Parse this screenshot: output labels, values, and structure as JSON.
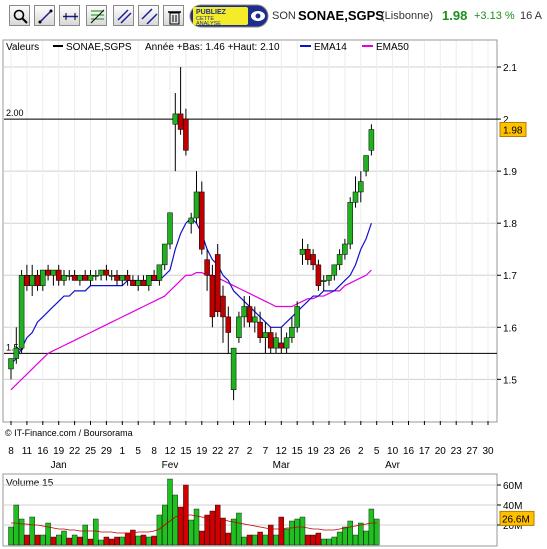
{
  "toolbar": {
    "tools": [
      {
        "icon": "zoom-icon"
      },
      {
        "icon": "trendline-icon"
      },
      {
        "icon": "horizontal-line-icon"
      },
      {
        "icon": "fibonacci-icon"
      },
      {
        "icon": "channel-icon"
      },
      {
        "icon": "parallel-lines-icon"
      },
      {
        "icon": "trash-icon"
      }
    ],
    "ad_line1": "PUBLIEZ",
    "ad_line2": "CETTE",
    "ad_line3": "ANALYSE"
  },
  "header": {
    "symbol_short": "SON",
    "symbol_name": "SONAE,SGPS",
    "exchange": "(Lisbonne)",
    "last_price": "1.98",
    "pct_change": "+3.13 %",
    "clock": "16 A"
  },
  "colors": {
    "up": "#20b020",
    "down": "#c00000",
    "ema14": "#1010d0",
    "ema50": "#e000e0",
    "volume_up": "#20c020",
    "volume_down": "#d00000",
    "grid": "#d0d0d0",
    "label_bg": "#ffc000"
  },
  "chart_data": [
    {
      "type": "candlestick",
      "legend": {
        "valeurs": "Valeurs",
        "symbol": "SONAE,SGPS",
        "range": "Année +Bas: 1.46 +Haut: 2.10",
        "ema14": "EMA14",
        "ema50": "EMA50"
      },
      "ylim": [
        1.42,
        2.15
      ],
      "yticks": [
        1.5,
        1.6,
        1.7,
        1.8,
        1.9,
        2,
        2.1
      ],
      "ytick_labels": [
        "1.5",
        "1.6",
        "1.7",
        "1.8",
        "1.9",
        "2",
        "2.1"
      ],
      "xticks": [
        0,
        3,
        6,
        9,
        12,
        15,
        18,
        21,
        24,
        27,
        30,
        33,
        36,
        39,
        42,
        45,
        48,
        51,
        54,
        57,
        60,
        63,
        66,
        69,
        72,
        75,
        78,
        81,
        84,
        87,
        90
      ],
      "xtick_labels": [
        "8",
        "11",
        "16",
        "19",
        "22",
        "25",
        "29",
        "1",
        "5",
        "8",
        "12",
        "15",
        "19",
        "22",
        "27",
        "2",
        "7",
        "12",
        "15",
        "19",
        "23",
        "26",
        "2",
        "5",
        "10",
        "16",
        "17",
        "20",
        "23",
        "27",
        "30"
      ],
      "month_labels": [
        {
          "label": "Jan",
          "x": 9
        },
        {
          "label": "Fev",
          "x": 30
        },
        {
          "label": "Mar",
          "x": 51
        },
        {
          "label": "Avr",
          "x": 72
        }
      ],
      "hlines": [
        {
          "value": 2.0,
          "label": "2.00"
        },
        {
          "value": 1.55,
          "label": "1.55"
        }
      ],
      "last_label": "1.98",
      "last_value": 1.98,
      "credit": "© IT-Finance.com / Boursorama",
      "candles": [
        {
          "x": 0,
          "o": 1.52,
          "h": 1.54,
          "l": 1.5,
          "c": 1.54
        },
        {
          "x": 1,
          "o": 1.54,
          "h": 1.6,
          "l": 1.53,
          "c": 1.56
        },
        {
          "x": 2,
          "o": 1.56,
          "h": 1.71,
          "l": 1.55,
          "c": 1.7
        },
        {
          "x": 3,
          "o": 1.7,
          "h": 1.72,
          "l": 1.67,
          "c": 1.68
        },
        {
          "x": 4,
          "o": 1.68,
          "h": 1.72,
          "l": 1.66,
          "c": 1.7
        },
        {
          "x": 5,
          "o": 1.7,
          "h": 1.71,
          "l": 1.67,
          "c": 1.68
        },
        {
          "x": 6,
          "o": 1.68,
          "h": 1.71,
          "l": 1.67,
          "c": 1.71
        },
        {
          "x": 7,
          "o": 1.71,
          "h": 1.72,
          "l": 1.69,
          "c": 1.7
        },
        {
          "x": 8,
          "o": 1.7,
          "h": 1.71,
          "l": 1.68,
          "c": 1.71
        },
        {
          "x": 9,
          "o": 1.71,
          "h": 1.72,
          "l": 1.68,
          "c": 1.69
        },
        {
          "x": 10,
          "o": 1.69,
          "h": 1.71,
          "l": 1.68,
          "c": 1.7
        },
        {
          "x": 11,
          "o": 1.7,
          "h": 1.71,
          "l": 1.69,
          "c": 1.7
        },
        {
          "x": 12,
          "o": 1.7,
          "h": 1.71,
          "l": 1.69,
          "c": 1.69
        },
        {
          "x": 13,
          "o": 1.69,
          "h": 1.7,
          "l": 1.68,
          "c": 1.7
        },
        {
          "x": 14,
          "o": 1.7,
          "h": 1.71,
          "l": 1.69,
          "c": 1.69
        },
        {
          "x": 15,
          "o": 1.69,
          "h": 1.71,
          "l": 1.68,
          "c": 1.7
        },
        {
          "x": 16,
          "o": 1.7,
          "h": 1.71,
          "l": 1.69,
          "c": 1.7
        },
        {
          "x": 17,
          "o": 1.7,
          "h": 1.71,
          "l": 1.69,
          "c": 1.71
        },
        {
          "x": 18,
          "o": 1.71,
          "h": 1.72,
          "l": 1.69,
          "c": 1.7
        },
        {
          "x": 19,
          "o": 1.7,
          "h": 1.71,
          "l": 1.69,
          "c": 1.7
        },
        {
          "x": 20,
          "o": 1.7,
          "h": 1.71,
          "l": 1.68,
          "c": 1.69
        },
        {
          "x": 21,
          "o": 1.69,
          "h": 1.7,
          "l": 1.68,
          "c": 1.7
        },
        {
          "x": 22,
          "o": 1.7,
          "h": 1.71,
          "l": 1.68,
          "c": 1.69
        },
        {
          "x": 23,
          "o": 1.69,
          "h": 1.7,
          "l": 1.68,
          "c": 1.68
        },
        {
          "x": 24,
          "o": 1.68,
          "h": 1.7,
          "l": 1.67,
          "c": 1.69
        },
        {
          "x": 25,
          "o": 1.69,
          "h": 1.7,
          "l": 1.68,
          "c": 1.68
        },
        {
          "x": 26,
          "o": 1.68,
          "h": 1.7,
          "l": 1.67,
          "c": 1.7
        },
        {
          "x": 27,
          "o": 1.7,
          "h": 1.71,
          "l": 1.69,
          "c": 1.69
        },
        {
          "x": 28,
          "o": 1.69,
          "h": 1.72,
          "l": 1.68,
          "c": 1.72
        },
        {
          "x": 29,
          "o": 1.72,
          "h": 1.76,
          "l": 1.71,
          "c": 1.76
        },
        {
          "x": 30,
          "o": 1.76,
          "h": 1.82,
          "l": 1.75,
          "c": 1.82
        },
        {
          "x": 31,
          "o": 1.99,
          "h": 2.05,
          "l": 1.9,
          "c": 2.01
        },
        {
          "x": 32,
          "o": 2.01,
          "h": 2.1,
          "l": 1.97,
          "c": 1.98
        },
        {
          "x": 33,
          "o": 2.0,
          "h": 2.02,
          "l": 1.93,
          "c": 1.94
        },
        {
          "x": 34,
          "o": 1.8,
          "h": 1.82,
          "l": 1.78,
          "c": 1.81
        },
        {
          "x": 35,
          "o": 1.81,
          "h": 1.9,
          "l": 1.8,
          "c": 1.86
        },
        {
          "x": 36,
          "o": 1.86,
          "h": 1.88,
          "l": 1.74,
          "c": 1.75
        },
        {
          "x": 37,
          "o": 1.73,
          "h": 1.75,
          "l": 1.67,
          "c": 1.7
        },
        {
          "x": 38,
          "o": 1.7,
          "h": 1.72,
          "l": 1.6,
          "c": 1.62
        },
        {
          "x": 39,
          "o": 1.74,
          "h": 1.76,
          "l": 1.62,
          "c": 1.63
        },
        {
          "x": 40,
          "o": 1.66,
          "h": 1.68,
          "l": 1.57,
          "c": 1.62
        },
        {
          "x": 41,
          "o": 1.62,
          "h": 1.64,
          "l": 1.55,
          "c": 1.59
        },
        {
          "x": 42,
          "o": 1.48,
          "h": 1.56,
          "l": 1.46,
          "c": 1.56
        },
        {
          "x": 43,
          "o": 1.58,
          "h": 1.63,
          "l": 1.57,
          "c": 1.62
        },
        {
          "x": 44,
          "o": 1.62,
          "h": 1.66,
          "l": 1.6,
          "c": 1.64
        },
        {
          "x": 45,
          "o": 1.64,
          "h": 1.66,
          "l": 1.6,
          "c": 1.61
        },
        {
          "x": 46,
          "o": 1.61,
          "h": 1.64,
          "l": 1.59,
          "c": 1.62
        },
        {
          "x": 47,
          "o": 1.61,
          "h": 1.63,
          "l": 1.57,
          "c": 1.58
        },
        {
          "x": 48,
          "o": 1.58,
          "h": 1.61,
          "l": 1.55,
          "c": 1.59
        },
        {
          "x": 49,
          "o": 1.59,
          "h": 1.6,
          "l": 1.55,
          "c": 1.56
        },
        {
          "x": 50,
          "o": 1.56,
          "h": 1.59,
          "l": 1.55,
          "c": 1.58
        },
        {
          "x": 51,
          "o": 1.57,
          "h": 1.6,
          "l": 1.55,
          "c": 1.56
        },
        {
          "x": 52,
          "o": 1.56,
          "h": 1.59,
          "l": 1.55,
          "c": 1.58
        },
        {
          "x": 53,
          "o": 1.58,
          "h": 1.62,
          "l": 1.57,
          "c": 1.6
        },
        {
          "x": 54,
          "o": 1.6,
          "h": 1.65,
          "l": 1.59,
          "c": 1.64
        },
        {
          "x": 55,
          "o": 1.74,
          "h": 1.77,
          "l": 1.72,
          "c": 1.75
        },
        {
          "x": 56,
          "o": 1.75,
          "h": 1.76,
          "l": 1.72,
          "c": 1.73
        },
        {
          "x": 57,
          "o": 1.74,
          "h": 1.75,
          "l": 1.71,
          "c": 1.72
        },
        {
          "x": 58,
          "o": 1.72,
          "h": 1.73,
          "l": 1.67,
          "c": 1.68
        },
        {
          "x": 59,
          "o": 1.69,
          "h": 1.7,
          "l": 1.67,
          "c": 1.69
        },
        {
          "x": 60,
          "o": 1.69,
          "h": 1.7,
          "l": 1.68,
          "c": 1.7
        },
        {
          "x": 61,
          "o": 1.7,
          "h": 1.72,
          "l": 1.69,
          "c": 1.72
        },
        {
          "x": 62,
          "o": 1.72,
          "h": 1.75,
          "l": 1.71,
          "c": 1.74
        },
        {
          "x": 63,
          "o": 1.74,
          "h": 1.77,
          "l": 1.73,
          "c": 1.76
        },
        {
          "x": 64,
          "o": 1.76,
          "h": 1.85,
          "l": 1.75,
          "c": 1.84
        },
        {
          "x": 65,
          "o": 1.84,
          "h": 1.89,
          "l": 1.83,
          "c": 1.86
        },
        {
          "x": 66,
          "o": 1.86,
          "h": 1.9,
          "l": 1.84,
          "c": 1.88
        },
        {
          "x": 67,
          "o": 1.9,
          "h": 1.93,
          "l": 1.89,
          "c": 1.93
        },
        {
          "x": 68,
          "o": 1.94,
          "h": 1.99,
          "l": 1.93,
          "c": 1.98
        }
      ],
      "ema14": [
        1.53,
        1.54,
        1.56,
        1.58,
        1.59,
        1.61,
        1.62,
        1.63,
        1.64,
        1.65,
        1.66,
        1.66,
        1.67,
        1.67,
        1.67,
        1.68,
        1.68,
        1.68,
        1.68,
        1.68,
        1.68,
        1.68,
        1.69,
        1.69,
        1.69,
        1.69,
        1.69,
        1.69,
        1.69,
        1.7,
        1.71,
        1.75,
        1.78,
        1.8,
        1.81,
        1.8,
        1.78,
        1.75,
        1.73,
        1.72,
        1.7,
        1.69,
        1.67,
        1.66,
        1.65,
        1.64,
        1.63,
        1.62,
        1.61,
        1.6,
        1.6,
        1.6,
        1.61,
        1.62,
        1.63,
        1.64,
        1.65,
        1.66,
        1.66,
        1.67,
        1.67,
        1.67,
        1.68,
        1.69,
        1.7,
        1.72,
        1.75,
        1.77,
        1.8
      ],
      "ema50": [
        1.48,
        1.49,
        1.5,
        1.51,
        1.52,
        1.53,
        1.54,
        1.55,
        1.555,
        1.56,
        1.565,
        1.57,
        1.575,
        1.58,
        1.585,
        1.59,
        1.595,
        1.6,
        1.605,
        1.61,
        1.615,
        1.62,
        1.625,
        1.63,
        1.635,
        1.64,
        1.645,
        1.65,
        1.655,
        1.66,
        1.67,
        1.68,
        1.69,
        1.7,
        1.7,
        1.705,
        1.705,
        1.7,
        1.7,
        1.695,
        1.69,
        1.685,
        1.68,
        1.675,
        1.67,
        1.665,
        1.66,
        1.655,
        1.65,
        1.645,
        1.64,
        1.64,
        1.64,
        1.64,
        1.645,
        1.65,
        1.655,
        1.655,
        1.66,
        1.66,
        1.665,
        1.67,
        1.67,
        1.68,
        1.685,
        1.69,
        1.695,
        1.7,
        1.71
      ]
    },
    {
      "type": "bar",
      "title": "Volume 15",
      "ylim": [
        0,
        70
      ],
      "yticks": [
        20,
        40,
        60
      ],
      "ytick_labels": [
        "20M",
        "40M",
        "60M"
      ],
      "last_label": "26.6M",
      "last_value": 26.6,
      "volumes": [
        18,
        40,
        26,
        10,
        28,
        10,
        10,
        22,
        8,
        10,
        14,
        7,
        10,
        8,
        20,
        6,
        26,
        5,
        8,
        6,
        8,
        8,
        12,
        15,
        9,
        10,
        8,
        9,
        30,
        40,
        66,
        50,
        38,
        60,
        25,
        36,
        14,
        30,
        34,
        40,
        27,
        12,
        26,
        32,
        8,
        10,
        10,
        13,
        10,
        20,
        10,
        28,
        16,
        24,
        26,
        28,
        10,
        10,
        12,
        6,
        6,
        8,
        13,
        18,
        24,
        10,
        22,
        14,
        36,
        26
      ],
      "volume_dirs": [
        1,
        1,
        1,
        0,
        1,
        0,
        1,
        1,
        0,
        1,
        1,
        0,
        1,
        0,
        1,
        0,
        1,
        1,
        0,
        0,
        0,
        1,
        0,
        0,
        1,
        0,
        1,
        0,
        1,
        1,
        1,
        1,
        0,
        0,
        1,
        1,
        0,
        0,
        0,
        0,
        0,
        0,
        1,
        1,
        1,
        0,
        1,
        0,
        1,
        0,
        1,
        0,
        1,
        1,
        1,
        1,
        0,
        0,
        0,
        1,
        1,
        1,
        1,
        1,
        1,
        1,
        1,
        1,
        1,
        1
      ],
      "moving_average": [
        22,
        22,
        21,
        21,
        20,
        20,
        19,
        18,
        17,
        16,
        16,
        15,
        15,
        14,
        14,
        14,
        14,
        13,
        13,
        13,
        12,
        12,
        12,
        12,
        13,
        13,
        13,
        14,
        16,
        20,
        24,
        28,
        30,
        30,
        30,
        29,
        28,
        27,
        26,
        26,
        25,
        24,
        23,
        22,
        21,
        20,
        19,
        18,
        17,
        16,
        16,
        16,
        17,
        17,
        18,
        18,
        17,
        16,
        16,
        15,
        15,
        15,
        16,
        17,
        18,
        19,
        20,
        21,
        22,
        22
      ]
    }
  ]
}
